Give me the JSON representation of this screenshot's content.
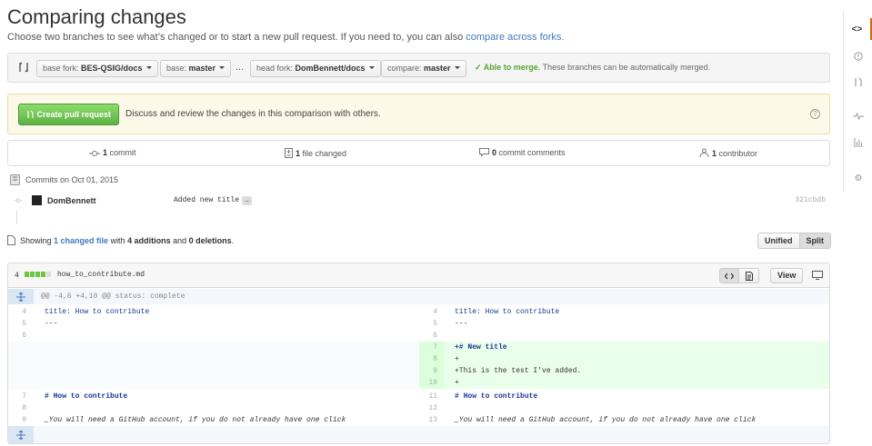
{
  "page": {
    "title": "Comparing changes",
    "subtitle": "Choose two branches to see what’s changed or to start a new pull request. If you need to, you can also ",
    "subtitle_link": "compare across forks."
  },
  "range": {
    "base_fork_label": "base fork: ",
    "base_fork_value": "BES-QSIG/docs",
    "base_label": "base: ",
    "base_value": "master",
    "ellipsis": "...",
    "head_fork_label": "head fork: ",
    "head_fork_value": "DomBennett/docs",
    "compare_label": "compare: ",
    "compare_value": "master",
    "merge_status": "✓ Able to merge.",
    "merge_note": " These branches can be automatically merged."
  },
  "flash": {
    "button": "Create pull request",
    "text": "Discuss and review the changes in this comparison with others.",
    "help": "?"
  },
  "numbers": {
    "commits_count": "1",
    "commits_label": " commit",
    "files_count": "1",
    "files_label": " file changed",
    "comments_count": "0",
    "comments_label": " commit comments",
    "contributors_count": "1",
    "contributors_label": " contributor"
  },
  "commits": {
    "header": "Commits on Oct 01, 2015",
    "author": "DomBennett",
    "message": "Added new title",
    "ellipsis": "…",
    "sha": "321cbdb"
  },
  "toc": {
    "prefix": "Showing ",
    "link": "1 changed file",
    "mid": " with ",
    "additions": "4 additions",
    "and": " and ",
    "deletions": "0 deletions",
    "end": ".",
    "unified": "Unified",
    "split": "Split"
  },
  "file": {
    "stat_count": "4",
    "name": "how_to_contribute.md",
    "view_button": "View",
    "hunk_header": "@@ -4,6 +4,10 @@ status: complete",
    "rows": [
      {
        "l_ln": "4",
        "l_code": "title: How to contribute",
        "r_ln": "4",
        "r_code": "title: How to contribute"
      },
      {
        "l_ln": "5",
        "l_code": "---",
        "r_ln": "5",
        "r_code": "---"
      },
      {
        "l_ln": "6",
        "l_code": "",
        "r_ln": "6",
        "r_code": ""
      }
    ],
    "added": [
      {
        "r_ln": "7",
        "r_code": "+# New title"
      },
      {
        "r_ln": "8",
        "r_code": "+"
      },
      {
        "r_ln": "9",
        "r_code": "+This is the test I've added."
      },
      {
        "r_ln": "10",
        "r_code": "+"
      }
    ],
    "rows2": [
      {
        "l_ln": "7",
        "l_code": "# How to contribute",
        "r_ln": "11",
        "r_code": "# How to contribute"
      },
      {
        "l_ln": "8",
        "l_code": "",
        "r_ln": "12",
        "r_code": ""
      },
      {
        "l_ln": "9",
        "l_code": "_You will need a GitHub account, if you do not already have one click",
        "r_ln": "13",
        "r_code": "_You will need a GitHub account, if you do not already have one click"
      }
    ]
  },
  "rightbar": {
    "code_icon": "<>",
    "issues_icon": "!",
    "pull_icon": "⇅",
    "pulse_icon": "~",
    "graphs_icon": "▥",
    "settings_icon": "⚙"
  },
  "colors": {
    "accent": "#4078c0",
    "green": "#60b044",
    "addition_bg": "#eaffea",
    "active_tab": "#d26911"
  }
}
